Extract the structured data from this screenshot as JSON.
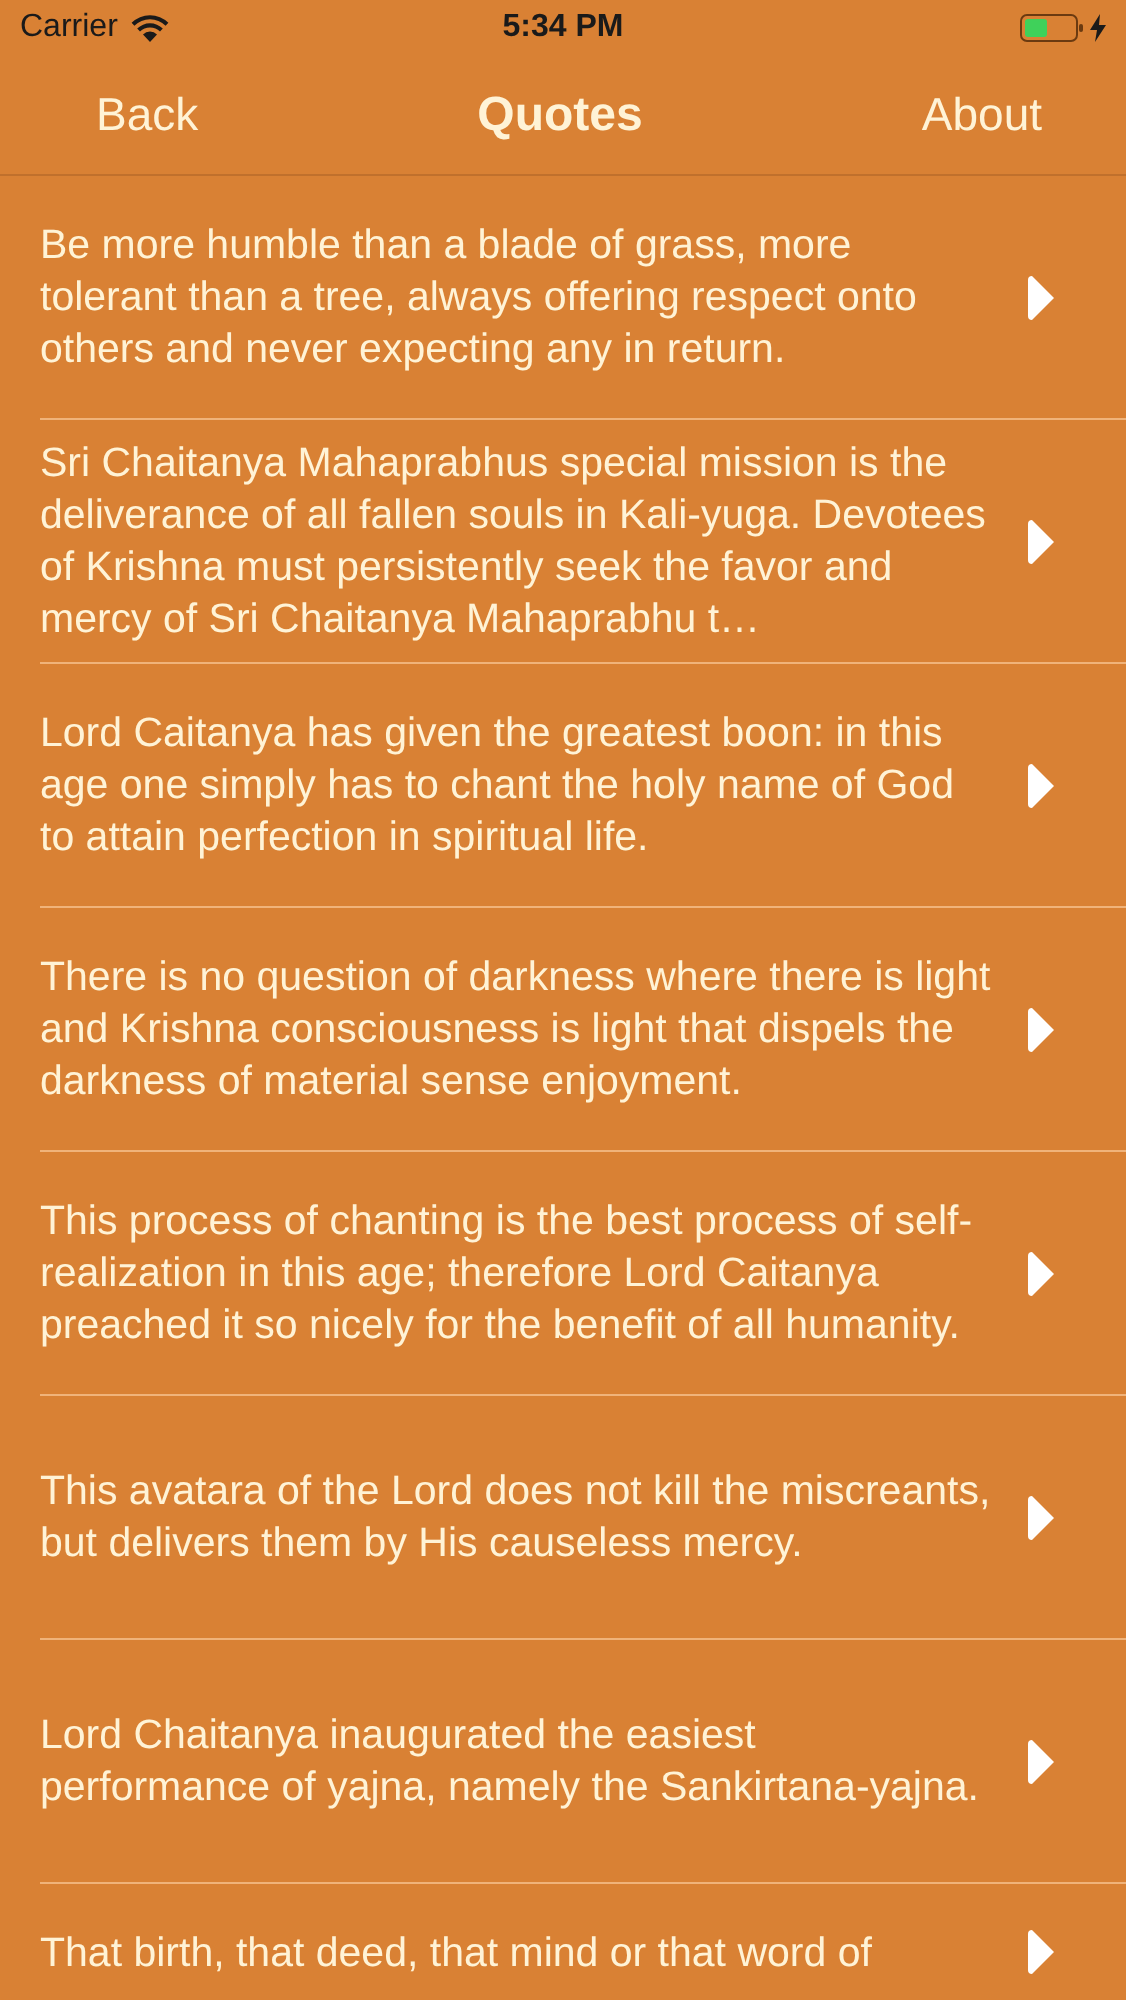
{
  "status_bar": {
    "carrier": "Carrier",
    "time": "5:34 PM"
  },
  "nav": {
    "back": "Back",
    "title": "Quotes",
    "about": "About"
  },
  "quotes": [
    {
      "text": "Be more humble than a blade of grass, more tolerant than a tree, always offering respect onto others and never expecting any in return."
    },
    {
      "text": "Sri Chaitanya Mahaprabhus special mission is the deliverance of all fallen souls in Kali-yuga. Devotees of Krishna must persistently seek the favor and mercy of Sri Chaitanya Mahaprabhu t…"
    },
    {
      "text": "Lord Caitanya has given the greatest boon: in this age one simply has to chant the holy name of God to attain perfection in spiritual life."
    },
    {
      "text": "There is no question of darkness where there is light and Krishna consciousness is light that dispels the darkness of material sense enjoyment."
    },
    {
      "text": "This process of chanting is the best process of self-realization in this age; therefore Lord Caitanya preached it so nicely for the benefit of all humanity."
    },
    {
      "text": "This avatara of the Lord does not kill the miscreants, but delivers them by His causeless mercy."
    },
    {
      "text": "Lord Chaitanya inaugurated the easiest performance of yajna, namely the Sankirtana-yajna."
    },
    {
      "text": "That birth, that deed, that mind or that word of"
    }
  ]
}
